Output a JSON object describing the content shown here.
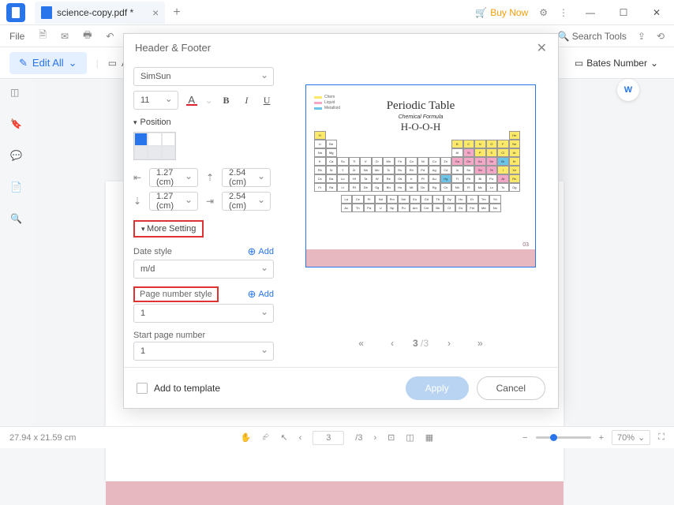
{
  "app": {
    "tab_title": "science-copy.pdf *",
    "buy_now": "Buy Now"
  },
  "menubar": {
    "file": "File",
    "search": "Search Tools"
  },
  "toolbar": {
    "edit_all": "Edit All",
    "add": "Add",
    "bates": "Bates Number"
  },
  "modal": {
    "title": "Header & Footer",
    "font_family": "SimSun",
    "font_size": "11",
    "position_label": "Position",
    "margins": {
      "left": "1.27 (cm)",
      "top": "2.54 (cm)",
      "bottom": "1.27 (cm)",
      "right": "2.54 (cm)"
    },
    "more_setting": "More Setting",
    "date_style_label": "Date style",
    "date_style_value": "m/d",
    "date_add": "Add",
    "page_style_label": "Page number style",
    "page_style_value": "1",
    "page_add": "Add",
    "start_page_label": "Start page number",
    "start_page_value": "1",
    "add_to_template": "Add to template",
    "apply": "Apply",
    "cancel": "Cancel",
    "pager": {
      "current": "3",
      "total": "/3"
    }
  },
  "preview": {
    "legend": {
      "a": "Chem",
      "b": "Liquid",
      "c": "Metalloid"
    },
    "title": "Periodic Table",
    "subtitle": "Chemical Formula",
    "formula": "H-O-O-H",
    "page_number": "03"
  },
  "statusbar": {
    "dimensions": "27.94 x 21.59 cm",
    "page_current": "3",
    "page_total": "/3",
    "zoom": "70%"
  }
}
